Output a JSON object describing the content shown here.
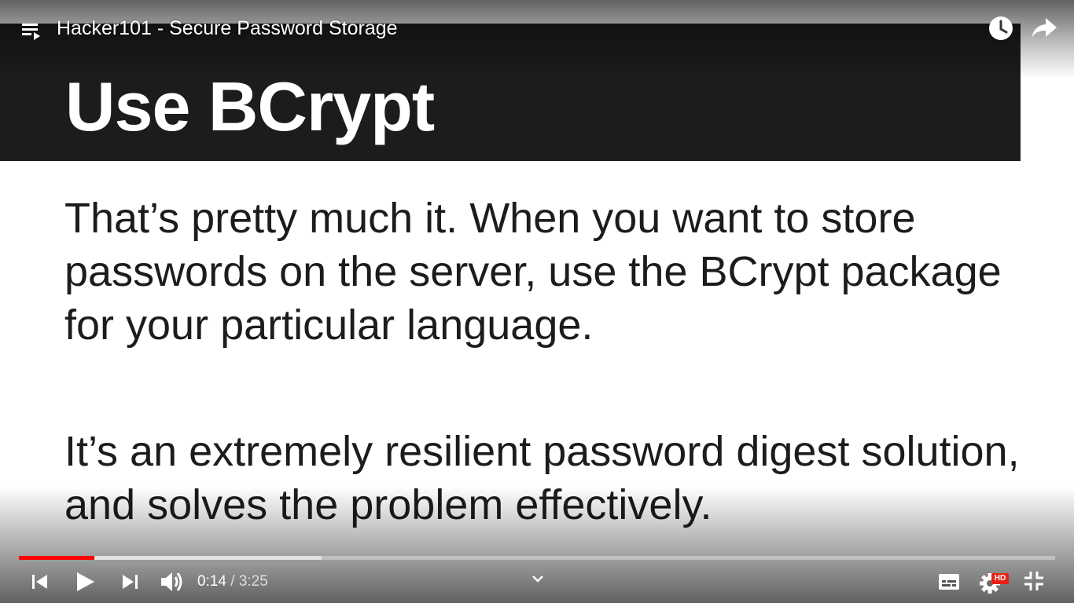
{
  "window": {
    "video_title": "Hacker101 - Secure Password Storage"
  },
  "slide": {
    "title": "Use BCrypt",
    "paragraph_1": "That’s pretty much it.  When you want to store passwords on the server, use the BCrypt package for your particular language.",
    "paragraph_2": "It’s an extremely resilient password digest solution, and solves the problem effectively."
  },
  "player": {
    "current_time": "0:14",
    "separator": " / ",
    "duration": "3:25",
    "progress_fraction": 0.073,
    "buffered_fraction": 0.292,
    "quality_badge": "HD",
    "colors": {
      "progress_played": "#ff0000",
      "hd_badge": "#e62117",
      "slide_header": "#1c1c1c"
    },
    "icons": [
      "playlist-icon",
      "watch-later-icon",
      "share-icon",
      "skip-previous-icon",
      "play-icon",
      "skip-next-icon",
      "volume-icon",
      "chevron-down-icon",
      "captions-icon",
      "settings-icon",
      "exit-fullscreen-icon"
    ]
  }
}
